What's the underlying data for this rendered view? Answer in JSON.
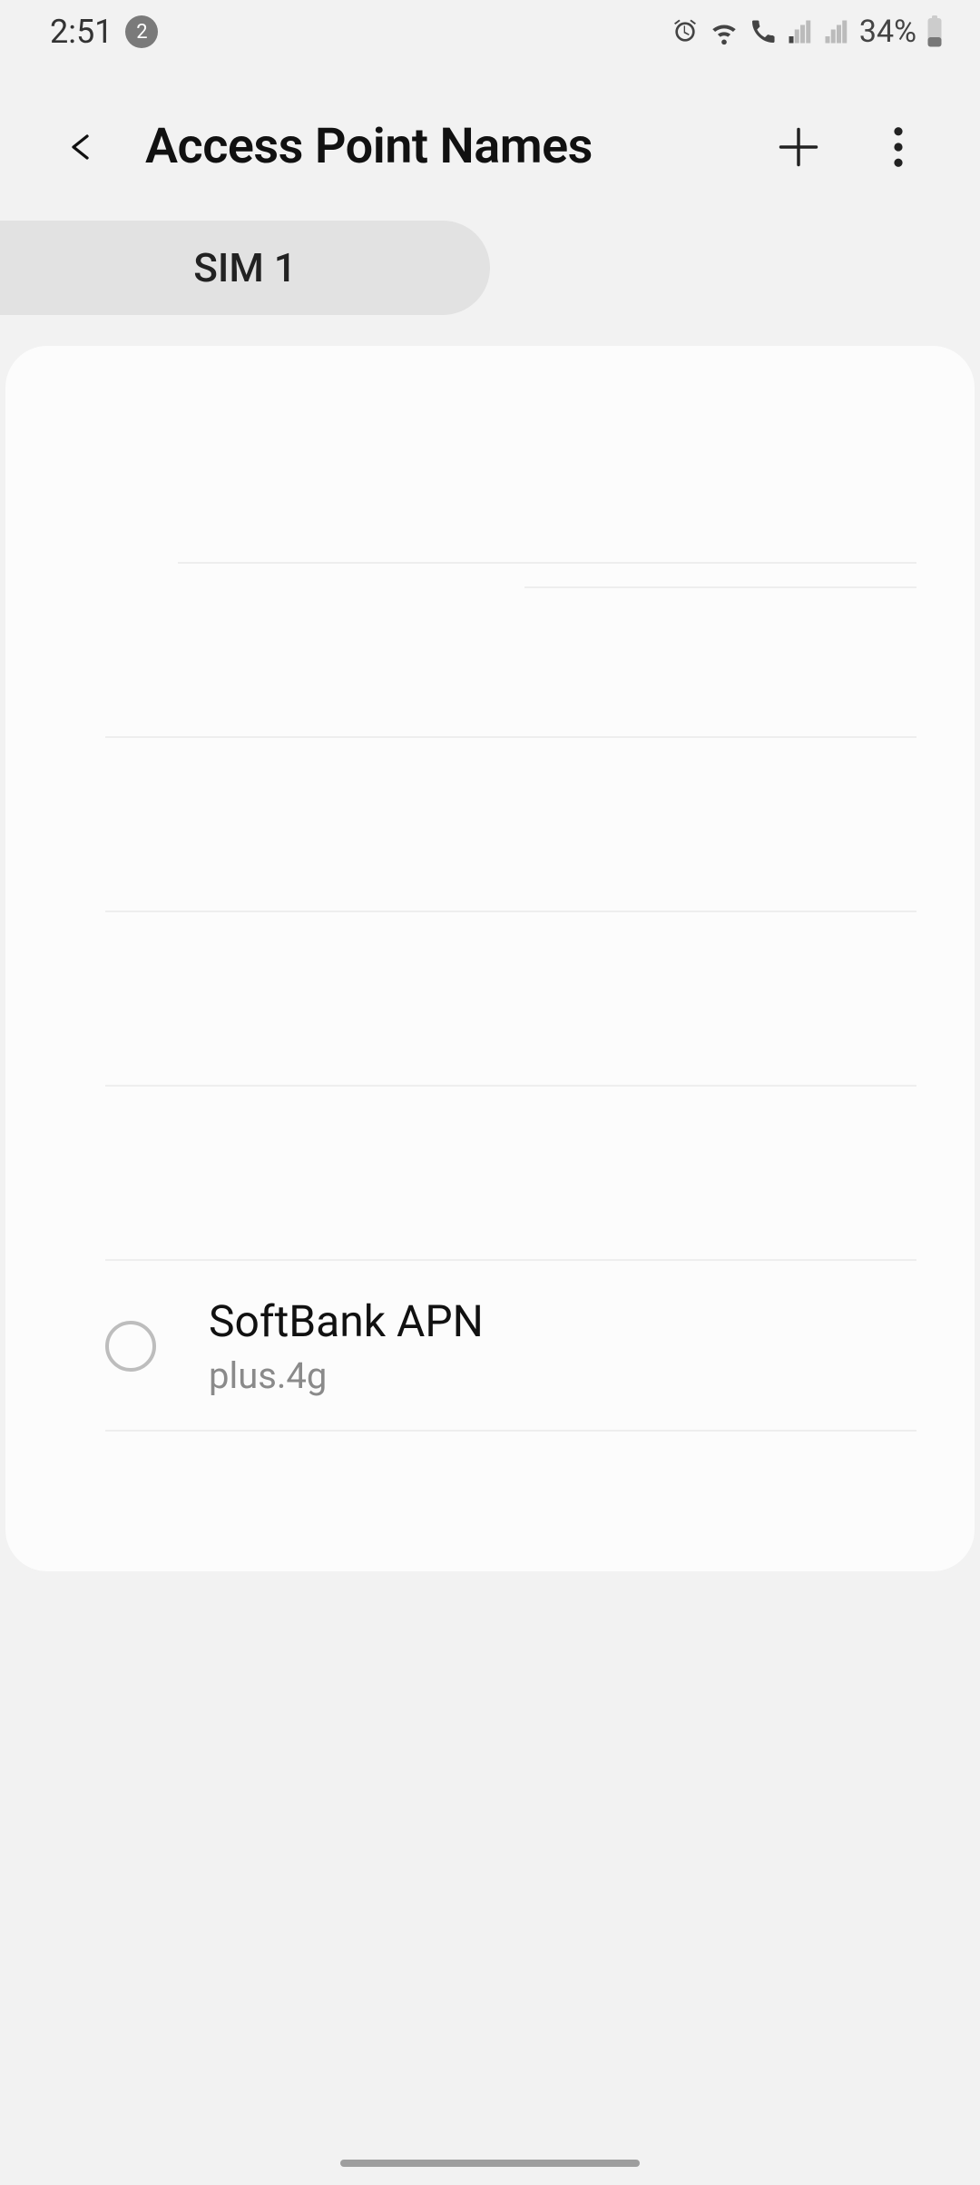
{
  "statusbar": {
    "time": "2:51",
    "notification_count": "2",
    "battery_pct": "34%"
  },
  "header": {
    "title": "Access Point Names"
  },
  "sim_tab": {
    "label": "SIM 1"
  },
  "apn_list": {
    "items": [
      {
        "name": "",
        "sub": ""
      },
      {
        "name": "",
        "sub": ""
      },
      {
        "name": "",
        "sub": ""
      },
      {
        "name": "",
        "sub": ""
      },
      {
        "name": "",
        "sub": ""
      },
      {
        "name": "SoftBank APN",
        "sub": "plus.4g"
      }
    ]
  }
}
